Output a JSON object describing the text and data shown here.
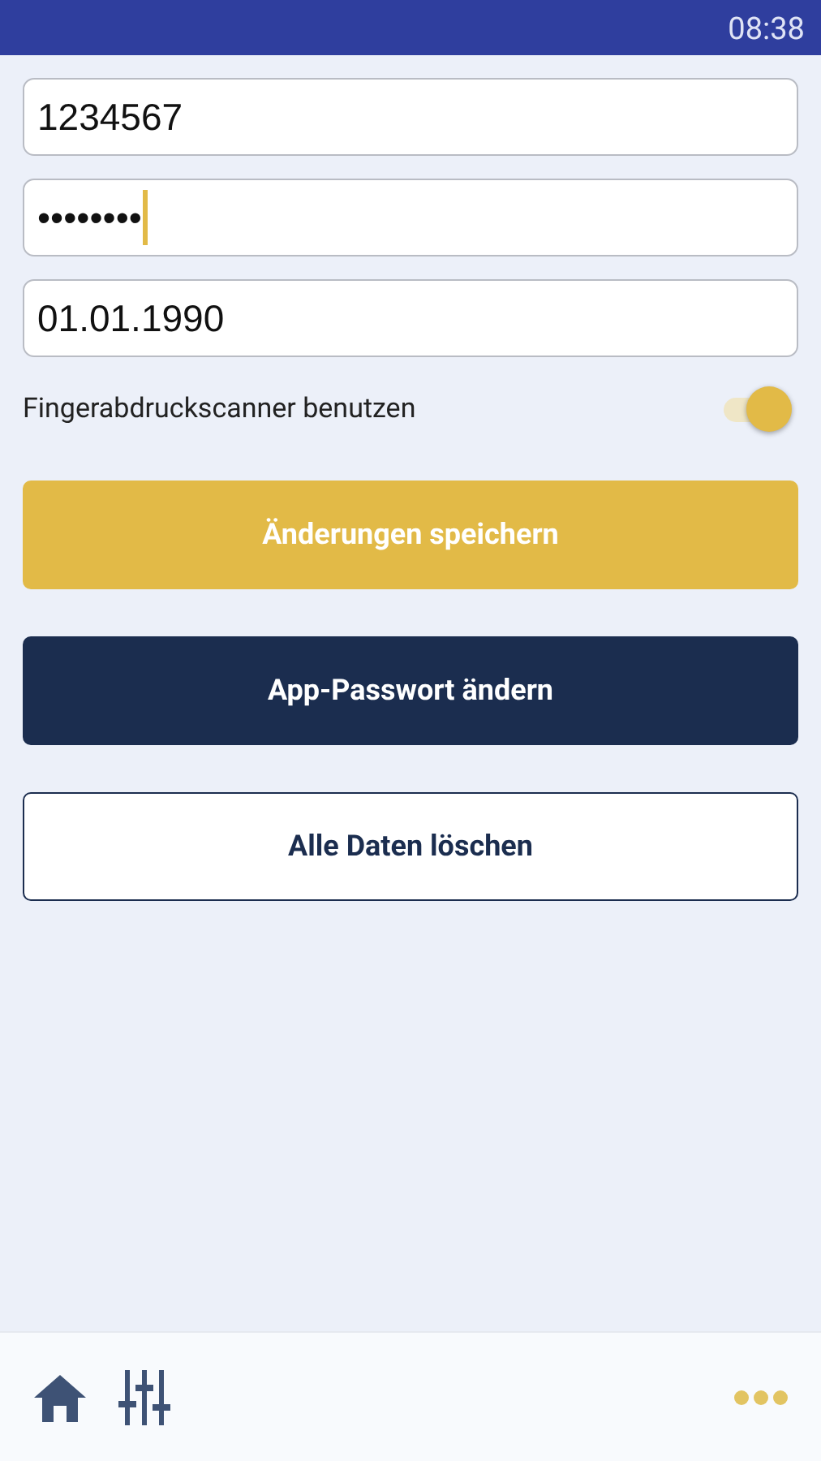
{
  "status_bar": {
    "time": "08:38"
  },
  "fields": [
    {
      "value": "1234567",
      "focused": false
    },
    {
      "value": "••••••••",
      "focused": true
    },
    {
      "value": "01.01.1990",
      "focused": false
    }
  ],
  "fingerprint": {
    "label": "Fingerabdruckscanner benutzen",
    "on": true
  },
  "buttons": [
    {
      "label": "Änderungen speichern",
      "kind": "primary"
    },
    {
      "label": "App-Passwort ändern",
      "kind": "dark"
    },
    {
      "label": "Alle Daten löschen",
      "kind": "outline"
    }
  ],
  "bottom_nav": [
    {
      "kind": "home"
    },
    {
      "kind": "settings"
    },
    {
      "kind": "more"
    }
  ]
}
